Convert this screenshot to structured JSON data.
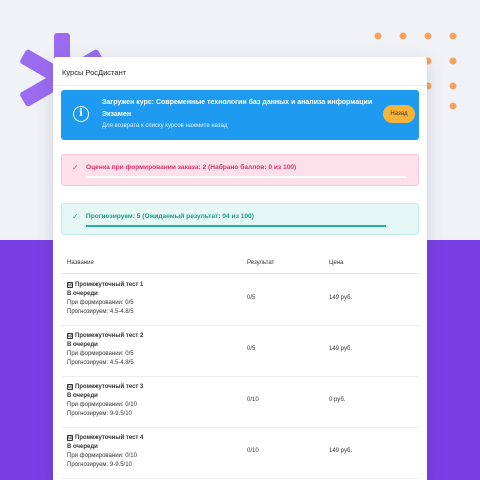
{
  "colors": {
    "accent_purple": "#7a3fe4",
    "info_blue": "#1e9bf0",
    "button_orange": "#f7b43a",
    "error_pink": "#d6336c",
    "success_teal": "#1d9e8a",
    "dots_orange": "#f4a460"
  },
  "window": {
    "title": "Курсы РосДистант"
  },
  "info": {
    "icon": "info-icon",
    "line1": "Загружен курс: Современные технологии баз данных и анализа информации",
    "line2": "Экзамен",
    "line3": "Для возврата к списку курсов нажмите назад",
    "back_label": "Назад"
  },
  "alerts": {
    "score": "Оценка при формировании заказа: 2 (Набрано баллов: 0 из 100)",
    "forecast": "Прогнозируем: 5 (Ожидаемый результат: 94 из 100)"
  },
  "table": {
    "headers": {
      "name": "Название",
      "result": "Результат",
      "price": "Цена"
    },
    "rows": [
      {
        "checkbox": "☑",
        "title": "Промежуточный тест 1",
        "status": "В очереди",
        "formation": "При формировании: 0/5",
        "forecast": "Прогнозируем: 4.5-4.8/5",
        "result": "0/5",
        "price": "149 руб."
      },
      {
        "checkbox": "☑",
        "title": "Промежуточный тест 2",
        "status": "В очереди",
        "formation": "При формировании: 0/5",
        "forecast": "Прогнозируем: 4.5-4.8/5",
        "result": "0/5",
        "price": "149 руб."
      },
      {
        "checkbox": "☑",
        "title": "Промежуточный тест 3",
        "status": "В очереди",
        "formation": "При формировании: 0/10",
        "forecast": "Прогнозируем: 9-9.5/10",
        "result": "0/10",
        "price": "0 руб."
      },
      {
        "checkbox": "☑",
        "title": "Промежуточный тест 4",
        "status": "В очереди",
        "formation": "При формировании: 0/10",
        "forecast": "Прогнозируем: 9-9.5/10",
        "result": "0/10",
        "price": "149 руб."
      }
    ]
  }
}
